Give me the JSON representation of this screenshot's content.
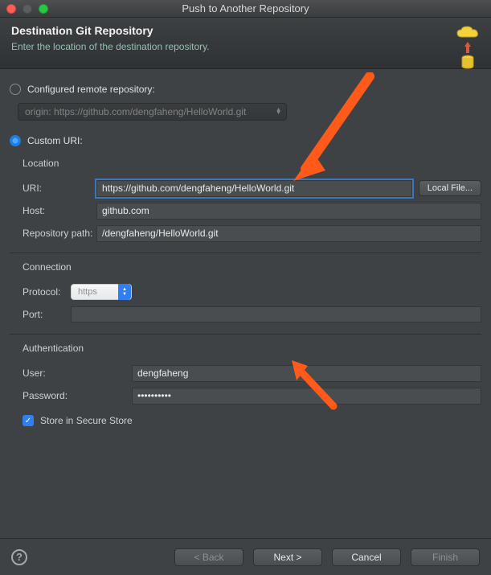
{
  "window": {
    "title": "Push to Another Repository"
  },
  "header": {
    "title": "Destination Git Repository",
    "subtitle": "Enter the location of the destination repository."
  },
  "options": {
    "configured_label": "Configured remote repository:",
    "configured_value": "origin: https://github.com/dengfaheng/HelloWorld.git",
    "custom_label": "Custom URI:"
  },
  "location": {
    "group": "Location",
    "uri_label": "URI:",
    "uri_value": "https://github.com/dengfaheng/HelloWorld.git",
    "local_file": "Local File...",
    "host_label": "Host:",
    "host_value": "github.com",
    "repo_label": "Repository path:",
    "repo_value": "/dengfaheng/HelloWorld.git"
  },
  "connection": {
    "group": "Connection",
    "protocol_label": "Protocol:",
    "protocol_value": "https",
    "port_label": "Port:",
    "port_value": ""
  },
  "auth": {
    "group": "Authentication",
    "user_label": "User:",
    "user_value": "dengfaheng",
    "pass_label": "Password:",
    "pass_value": "••••••••••",
    "store_label": "Store in Secure Store"
  },
  "footer": {
    "back": "< Back",
    "next": "Next >",
    "cancel": "Cancel",
    "finish": "Finish"
  }
}
